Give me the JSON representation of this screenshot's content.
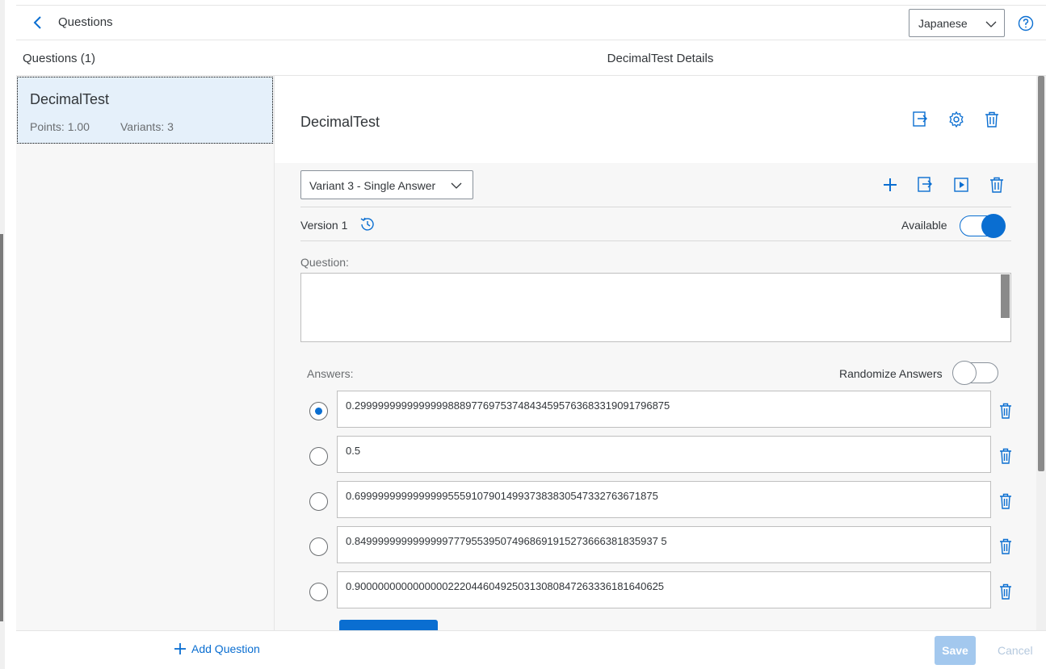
{
  "topbar": {
    "title": "Questions",
    "language": "Japanese"
  },
  "master": {
    "header": "Questions (1)",
    "items": [
      {
        "name": "DecimalTest",
        "points": "Points: 1.00",
        "variants": "Variants: 3"
      }
    ],
    "add_question": "Add Question"
  },
  "detail": {
    "header": "DecimalTest Details",
    "object_title": "DecimalTest",
    "variant_select": "Variant 3 - Single Answer",
    "version": "Version 1",
    "available_label": "Available",
    "available": true,
    "question_label": "Question:",
    "question_text": "",
    "answers_label": "Answers:",
    "randomize_label": "Randomize Answers",
    "randomize": false,
    "answers": [
      {
        "value": "0.299999999999999988897769753748434595763683319091796875",
        "selected": true
      },
      {
        "value": "0.5",
        "selected": false
      },
      {
        "value": "0.6999999999999999555910790149937383830547332763671875",
        "selected": false
      },
      {
        "value": "0.8499999999999999777955395074968691915273666381835937 5",
        "selected": false
      },
      {
        "value": "0.90000000000000002220446049250313080847263336181640625",
        "selected": false
      }
    ]
  },
  "footer": {
    "save": "Save",
    "cancel": "Cancel"
  },
  "colors": {
    "accent": "#0a6ed1",
    "selected_bg": "#e5f0fa",
    "disabled_save": "#a3c8ee"
  }
}
